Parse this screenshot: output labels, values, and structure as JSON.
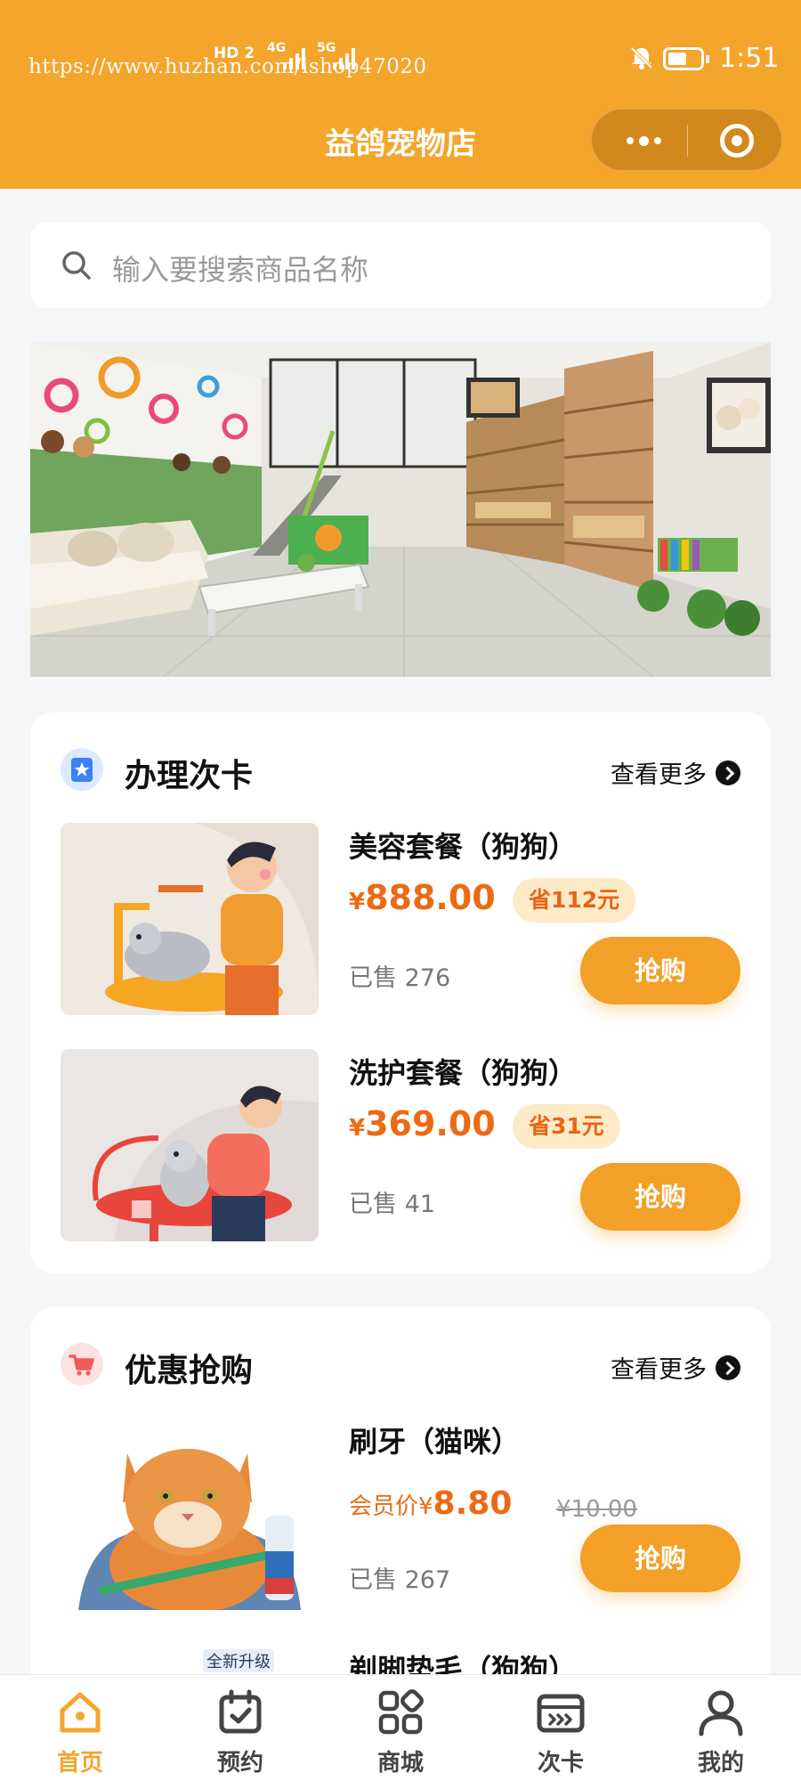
{
  "status_bar": {
    "url_watermark": "https://www.huzhan.com/ishop47020",
    "network_badge": "HD",
    "sim_slot": "2",
    "signal1": "4G",
    "signal2": "5G",
    "time": "1:51",
    "battery_level": 0.6
  },
  "header": {
    "title": "益鸽宠物店",
    "accent_color": "#f3a52c"
  },
  "search": {
    "placeholder": "输入要搜索商品名称"
  },
  "banner": {
    "icon": "pet-store-interior-image"
  },
  "cards_section": {
    "title": "办理次卡",
    "more": "查看更多",
    "items": [
      {
        "name": "美容套餐（狗狗）",
        "currency": "¥",
        "price": "888.00",
        "save": "省112元",
        "sold": "已售 276",
        "buy": "抢购"
      },
      {
        "name": "洗护套餐（狗狗）",
        "currency": "¥",
        "price": "369.00",
        "save": "省31元",
        "sold": "已售 41",
        "buy": "抢购"
      }
    ]
  },
  "flash_section": {
    "title": "优惠抢购",
    "more": "查看更多",
    "items": [
      {
        "name": "刷牙（猫咪）",
        "member_label": "会员价¥",
        "member_price": "8.80",
        "original_price": "¥10.00",
        "sold": "已售 267",
        "buy": "抢购"
      },
      {
        "name": "剃脚垫毛（狗狗）",
        "badge": "全新升级"
      }
    ]
  },
  "tabbar": {
    "items": [
      {
        "label": "首页",
        "icon": "home-icon",
        "active": true
      },
      {
        "label": "预约",
        "icon": "calendar-check-icon"
      },
      {
        "label": "商城",
        "icon": "grid-icon"
      },
      {
        "label": "次卡",
        "icon": "ticket-icon"
      },
      {
        "label": "我的",
        "icon": "user-icon"
      }
    ]
  }
}
